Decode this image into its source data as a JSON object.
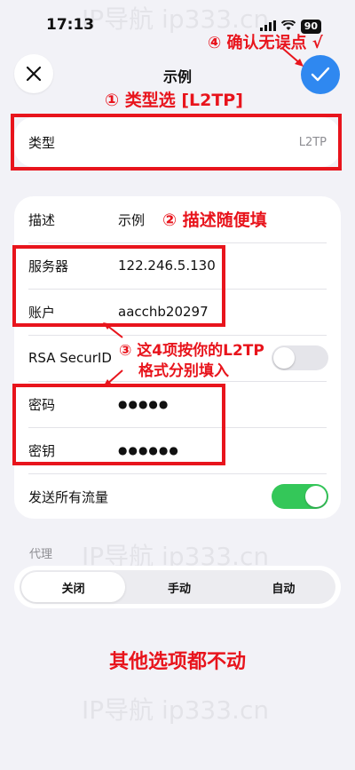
{
  "status": {
    "time": "17:13",
    "battery": "90"
  },
  "nav": {
    "title": "示例"
  },
  "type_row": {
    "label": "类型",
    "value": "L2TP"
  },
  "fields": {
    "description": {
      "label": "描述",
      "value": "示例"
    },
    "server": {
      "label": "服务器",
      "value": "122.246.5.130"
    },
    "account": {
      "label": "账户",
      "value": "aacchb20297"
    },
    "rsa": {
      "label": "RSA SecurID"
    },
    "password": {
      "label": "密码",
      "value": "●●●●●"
    },
    "secret": {
      "label": "密钥",
      "value": "●●●●●●"
    },
    "send_all": {
      "label": "发送所有流量"
    }
  },
  "toggles": {
    "rsa_on": false,
    "send_all_on": true,
    "on_color": "#34c759",
    "off_color": "#e5e5ea"
  },
  "proxy": {
    "section_label": "代理",
    "options": [
      "关闭",
      "手动",
      "自动"
    ],
    "selected": "关闭"
  },
  "annotations": {
    "step1": "① 类型选 [L2TP]",
    "step2": "② 描述随便填",
    "step3_line1": "③ 这4项按你的L2TP",
    "step3_line2": "格式分别填入",
    "step4": "④ 确认无误点 √",
    "footer": "其他选项都不动"
  },
  "watermark": "IP导航  ip333.cn",
  "colors": {
    "accent": "#2f88f0",
    "annotation": "#e8141c"
  }
}
